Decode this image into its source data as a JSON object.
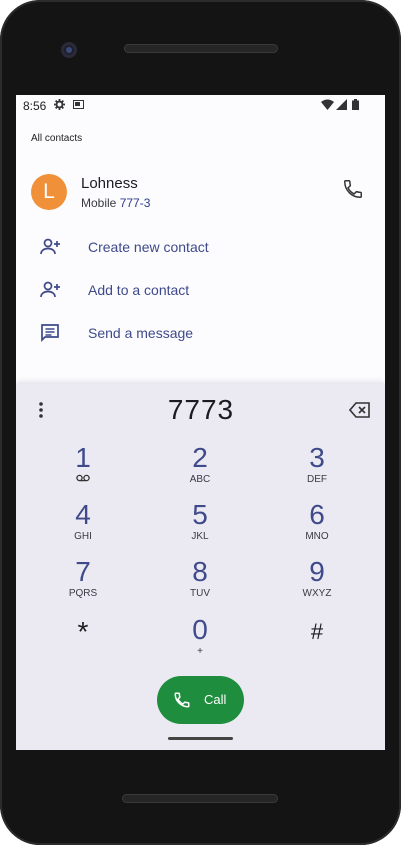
{
  "status_bar": {
    "time": "8:56"
  },
  "header": {
    "section_label": "All contacts"
  },
  "contact": {
    "initial": "L",
    "name": "Lohness",
    "phone_type": "Mobile",
    "phone_number": "777-3",
    "avatar_color": "#f0913a"
  },
  "actions": [
    {
      "label": "Create new contact",
      "icon": "add-person-icon"
    },
    {
      "label": "Add to a contact",
      "icon": "add-person-icon"
    },
    {
      "label": "Send a message",
      "icon": "message-icon"
    }
  ],
  "dialpad": {
    "entered_digits": "7773",
    "keys": [
      {
        "num": "1",
        "letters": ""
      },
      {
        "num": "2",
        "letters": "ABC"
      },
      {
        "num": "3",
        "letters": "DEF"
      },
      {
        "num": "4",
        "letters": "GHI"
      },
      {
        "num": "5",
        "letters": "JKL"
      },
      {
        "num": "6",
        "letters": "MNO"
      },
      {
        "num": "7",
        "letters": "PQRS"
      },
      {
        "num": "8",
        "letters": "TUV"
      },
      {
        "num": "9",
        "letters": "WXYZ"
      },
      {
        "num": "*",
        "letters": ""
      },
      {
        "num": "0",
        "letters": "+"
      },
      {
        "num": "#",
        "letters": ""
      }
    ],
    "call_label": "Call",
    "call_color": "#1e8e3e"
  }
}
